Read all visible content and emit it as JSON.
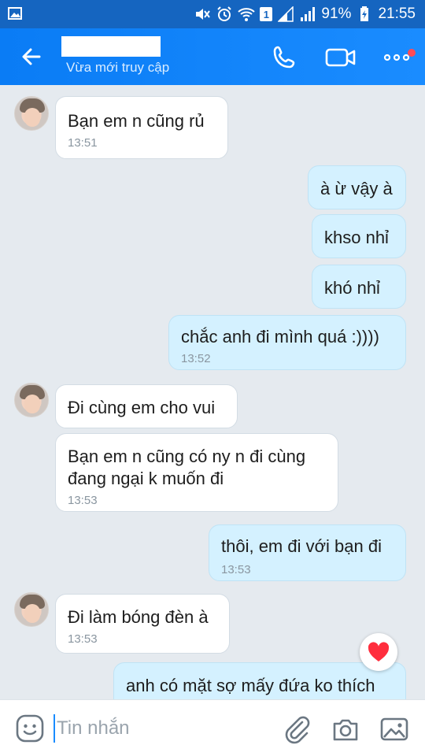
{
  "status_bar": {
    "battery_percent": "91%",
    "time": "21:55",
    "sim_label": "1",
    "icons": [
      "image-icon",
      "mute-icon",
      "alarm-icon",
      "wifi-icon",
      "sim-icon",
      "signal-icon",
      "signal-icon-2",
      "battery-charging-icon"
    ]
  },
  "header": {
    "subtitle": "Vừa mới truy cập",
    "icons": [
      "back-arrow-icon",
      "phone-icon",
      "video-icon",
      "more-icon"
    ]
  },
  "messages": [
    {
      "side": "in",
      "text": "Bạn em n cũng rủ",
      "time": "13:51",
      "avatar": true
    },
    {
      "side": "out",
      "text": "à ừ vậy à",
      "time": ""
    },
    {
      "side": "out",
      "text": "khso nhỉ",
      "time": ""
    },
    {
      "side": "out",
      "text": "khó nhỉ",
      "time": ""
    },
    {
      "side": "out",
      "text": "chắc anh đi mình quá :))))",
      "time": "13:52"
    },
    {
      "side": "in",
      "text": "Đi cùng em cho vui",
      "time": "",
      "avatar": true
    },
    {
      "side": "in",
      "text_line1": "Bạn em n cũng có ny n đi cùng",
      "text_line2": "đang ngại k muốn đi",
      "time": "13:53"
    },
    {
      "side": "out",
      "text": "thôi, em đi với bạn đi",
      "time": "13:53"
    },
    {
      "side": "in",
      "text": "Đi làm bóng đèn à",
      "time": "13:53",
      "avatar": true
    },
    {
      "side": "out",
      "text": "anh có mặt sợ mấy đứa ko thích",
      "time": ""
    }
  ],
  "input": {
    "placeholder": "Tin nhắn",
    "icons": [
      "emoji-icon",
      "attach-icon",
      "camera-icon",
      "image-icon"
    ]
  },
  "colors": {
    "header": "#1a8cff",
    "status_bar": "#1565c0",
    "chat_bg": "#e5eaef",
    "out_bubble": "#d4f1ff",
    "heart": "#ff2d3d"
  }
}
